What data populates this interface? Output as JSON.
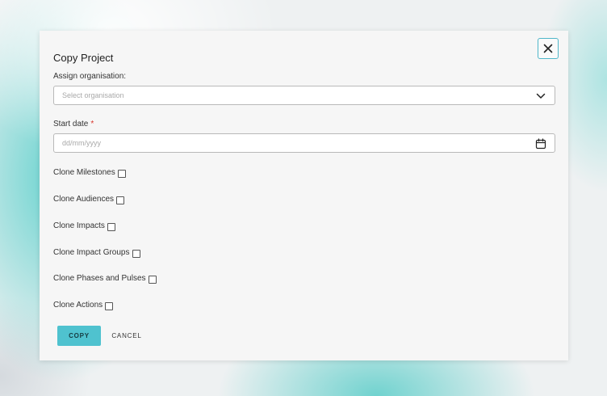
{
  "dialog": {
    "title": "Copy Project",
    "close_icon": "close-icon"
  },
  "organisation": {
    "label": "Assign organisation:",
    "placeholder": "Select organisation",
    "icon": "chevron-down-icon"
  },
  "start_date": {
    "label": "Start date",
    "required_marker": "*",
    "placeholder": "dd/mm/yyyy",
    "icon": "calendar-icon"
  },
  "options": [
    {
      "label": "Clone Milestones",
      "checked": false
    },
    {
      "label": "Clone Audiences",
      "checked": false
    },
    {
      "label": "Clone Impacts",
      "checked": false
    },
    {
      "label": "Clone Impact Groups",
      "checked": false
    },
    {
      "label": "Clone Phases and Pulses",
      "checked": false
    },
    {
      "label": "Clone Actions",
      "checked": false
    }
  ],
  "actions": {
    "copy_label": "COPY",
    "cancel_label": "CANCEL"
  },
  "colors": {
    "accent": "#4fc2cf",
    "required": "#d9342b"
  }
}
